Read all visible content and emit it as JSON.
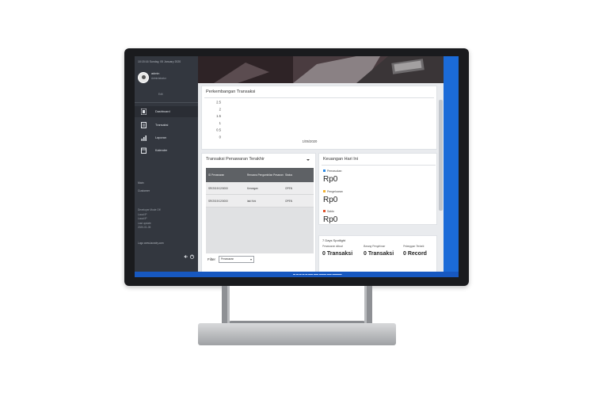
{
  "sidebar": {
    "clock": "10:15:16 Sunday, 05 January 2020",
    "user_name": "admin",
    "user_role": "Administrator",
    "edit_label": "Edit",
    "nav": [
      {
        "label": "Dashboard",
        "icon": "dashboard-icon"
      },
      {
        "label": "Transaksi",
        "icon": "transaction-icon"
      },
      {
        "label": "Laporan",
        "icon": "report-icon"
      },
      {
        "label": "Kalender",
        "icon": "calendar-icon"
      }
    ],
    "menu_title": "Main",
    "customer_label": "Customer",
    "developer_lines": [
      "Developer Mode Off",
      "Local IP",
      "Local IP",
      "Last update",
      "2020-01-05"
    ],
    "footer_text": "Logo      www.laundry.com",
    "bottom_icons": [
      "logout-icon",
      "power-icon"
    ]
  },
  "chart_card": {
    "title": "Perkembangan Transaksi"
  },
  "chart_data": {
    "type": "line",
    "title": "Perkembangan Transaksi",
    "x": [
      "1/05/2020"
    ],
    "series": [
      {
        "values": [
          0
        ]
      }
    ],
    "y_ticks": [
      "2.5",
      "2",
      "1.5",
      "1",
      "0.5",
      "0"
    ],
    "ylim": [
      0,
      2.5
    ],
    "xlabel": "",
    "ylabel": "",
    "grid": false
  },
  "transaksi_card": {
    "title": "Transaksi Penawaran Terakhir",
    "columns": [
      "ID Penawaran",
      "Rencana Pengambilan Pesanan",
      "Status"
    ],
    "rows": [
      [
        "SR/2019/12/0000",
        "Kerangan",
        "OPEN"
      ],
      [
        "SR/2019/12/0000",
        "laki Kek",
        "OPEN"
      ]
    ],
    "filter_label": "Filter",
    "filter_value": "Penawaran"
  },
  "keuangan_card": {
    "title": "Keuangan Hari Ini",
    "items": [
      {
        "label": "Pemasukan",
        "value": "Rp0",
        "color": "#2e8be6"
      },
      {
        "label": "Pengeluaran",
        "value": "Rp0",
        "color": "#f2b234"
      },
      {
        "label": "Saldo",
        "value": "Rp0",
        "color": "#e0522c"
      }
    ]
  },
  "spotlight_card": {
    "title": "7 Days Spotlight",
    "stats": [
      {
        "label": "Penawaran dibuat",
        "value": "0 Transaksi"
      },
      {
        "label": "Barang Pengiriman",
        "value": "0 Transaksi"
      },
      {
        "label": "Pelanggan Terbaik",
        "value": "0 Record"
      }
    ]
  },
  "taskbar": {
    "tray_text": "▬ ▬ ▬ ▬ ▬   ▬▬   ▬▬   ▬▬▬   ▬▬   ▬▬▬▬"
  }
}
